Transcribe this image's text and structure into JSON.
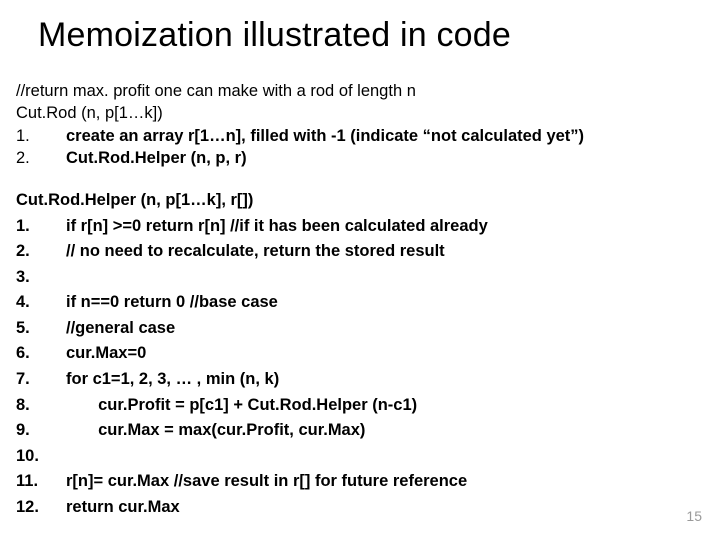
{
  "title": "Memoization illustrated in code",
  "block1": {
    "comment": "//return max. profit one can make with a rod of length n",
    "sig": "Cut.Rod (n, p[1…k])",
    "l1_num": "1.",
    "l1_txt": "create an array r[1…n], filled with -1 (indicate “not calculated yet”)",
    "l2_num": "2.",
    "l2_txt": "Cut.Rod.Helper (n, p, r)"
  },
  "block2": {
    "sig": "Cut.Rod.Helper (n, p[1…k], r[])",
    "l1_num": "1.",
    "l1_txt": "if r[n] >=0 return r[n]  //if it has been calculated already",
    "l2_num": "2.",
    "l2_txt": " // no need to recalculate, return the stored result",
    "l3_num": "3.",
    "l4_num": "4.",
    "l4_txt": "if n==0 return 0 //base case",
    "l5_num": "5.",
    "l5_txt": "//general case",
    "l6_num": "6.",
    "l6_txt": "cur.Max=0",
    "l7_num": "7.",
    "l7_txt": "for  c1=1, 2, 3, … ,  min (n, k)",
    "l8_num": "8.",
    "l8_txt": "cur.Profit = p[c1] + Cut.Rod.Helper (n-c1)",
    "l9_num": "9.",
    "l9_txt": "cur.Max = max(cur.Profit, cur.Max)",
    "l10_num": "10.",
    "l11_num": "11.",
    "l11_txt": "r[n]= cur.Max   //save result in r[] for future reference",
    "l12_num": "12.",
    "l12_txt": "return cur.Max"
  },
  "page_number": "15"
}
